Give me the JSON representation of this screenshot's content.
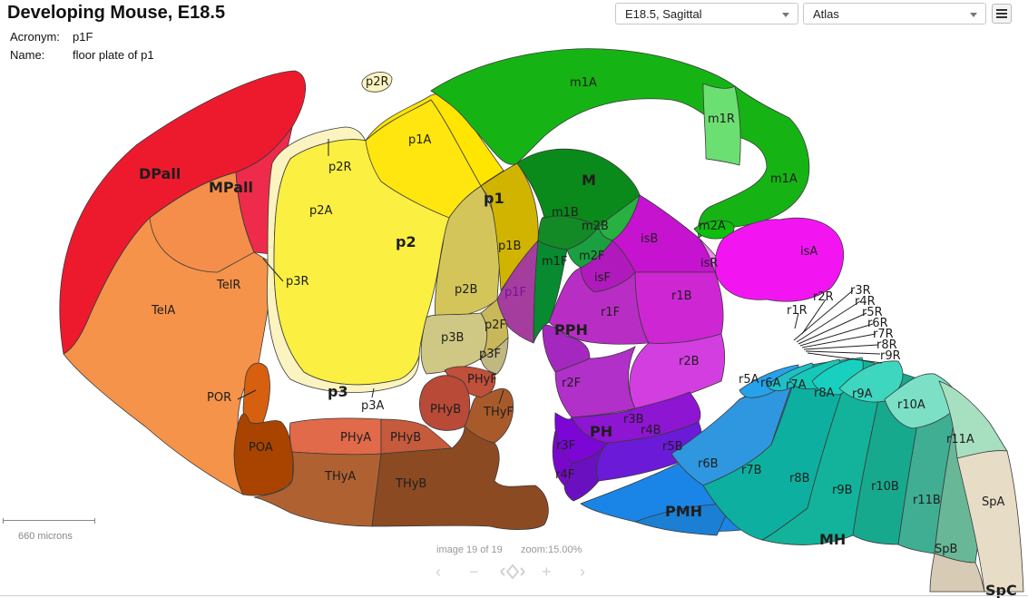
{
  "header": {
    "title": "Developing Mouse, E18.5",
    "acronym_label": "Acronym:",
    "acronym_value": "p1F",
    "name_label": "Name:",
    "name_value": "floor plate of p1",
    "plane_select": "E18.5, Sagittal",
    "atlas_select": "Atlas",
    "menu_icon": "hamburger-menu-icon"
  },
  "selected_region": "p1F",
  "colors": {
    "selection_outline": "#000000",
    "selected_fill": "#a43d9d"
  },
  "labels": {
    "DPall": "DPall",
    "MPall": "MPall",
    "TelR": "TelR",
    "TelA": "TelA",
    "POR": "POR",
    "POA": "POA",
    "p2R_top": "p2R",
    "p2R": "p2R",
    "p3R": "p3R",
    "p2A": "p2A",
    "p2": "p2",
    "p3": "p3",
    "p3A": "p3A",
    "p1A": "p1A",
    "p1": "p1",
    "p1B": "p1B",
    "p2B": "p2B",
    "p1F": "p1F",
    "p2F": "p2F",
    "p3B": "p3B",
    "p3F": "p3F",
    "PHyF": "PHyF",
    "PHyB": "PHyB",
    "THyF": "THyF",
    "PHyA": "PHyA",
    "PHyB2": "PHyB",
    "THyA": "THyA",
    "THyB": "THyB",
    "m1A_top": "m1A",
    "m1R": "m1R",
    "m1A": "m1A",
    "M": "M",
    "m1B": "m1B",
    "m2B": "m2B",
    "m1F": "m1F",
    "m2F": "m2F",
    "m2A": "m2A",
    "isB": "isB",
    "isF": "isF",
    "isR": "isR",
    "isA": "isA",
    "r1B": "r1B",
    "r1F": "r1F",
    "PPH": "PPH",
    "r2F": "r2F",
    "r2B": "r2B",
    "r3B": "r3B",
    "r4B": "r4B",
    "PH": "PH",
    "r3F": "r3F",
    "r4F": "r4F",
    "r5B": "r5B",
    "r6B": "r6B",
    "r7B": "r7B",
    "r8B": "r8B",
    "r9B": "r9B",
    "r10B": "r10B",
    "r11B": "r11B",
    "PMH": "PMH",
    "MH": "MH",
    "r5A": "r5A",
    "r6A": "r6A",
    "r7A": "r7A",
    "r8A": "r8A",
    "r9A": "r9A",
    "r10A": "r10A",
    "r11A": "r11A",
    "SpA": "SpA",
    "SpB": "SpB",
    "SpC": "SpC",
    "r1R": "r1R",
    "r2R": "r2R",
    "r3R": "r3R",
    "r4R": "r4R",
    "r5R": "r5R",
    "r6R": "r6R",
    "r7R": "r7R",
    "r8R": "r8R",
    "r9R": "r9R"
  },
  "footer": {
    "scale": "660 microns",
    "image_counter": "image 19 of 19",
    "zoom": "zoom:15.00%",
    "nav_icons": [
      "prev-arrow-icon",
      "zoom-out-icon",
      "fit-view-icon",
      "zoom-in-icon",
      "next-arrow-icon"
    ]
  }
}
